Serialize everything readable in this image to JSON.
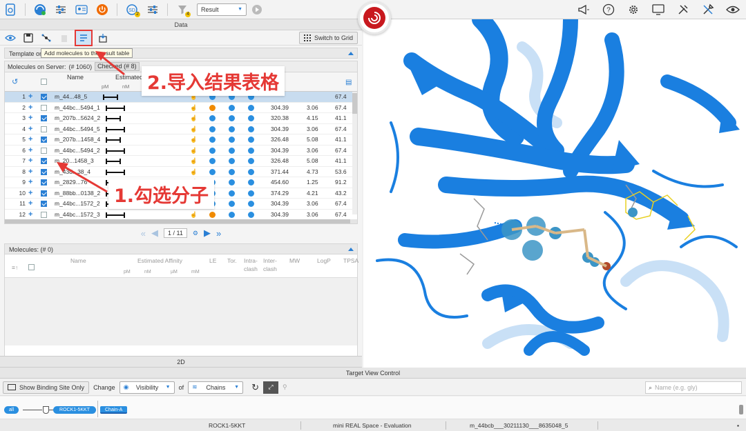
{
  "toolbar": {
    "result_dropdown": "Result",
    "badge_stack": "2",
    "badge_filter": "4"
  },
  "data_panel": {
    "title": "Data",
    "tooltip": "Add molecules to the result table",
    "switch_grid": "Switch to Grid",
    "template_bar": "Template or",
    "server_title": "Molecules on Server:",
    "server_count": "(# 1060)",
    "checked_chip": "Checked",
    "checked_count": "8",
    "headers": {
      "name": "Name",
      "affinity": "Estimated",
      "pm": "pM",
      "nm": "nM"
    },
    "rows": [
      {
        "num": "1",
        "checked": true,
        "name": "m_44...48_5",
        "mw": "",
        "logp": "",
        "tpsa": "67.4",
        "dot2": "#2a8fe0",
        "sel": true
      },
      {
        "num": "2",
        "checked": false,
        "name": "m_44bc...5494_1",
        "mw": "304.39",
        "logp": "3.06",
        "tpsa": "67.4",
        "dot2": "#f08a00",
        "sel": false
      },
      {
        "num": "3",
        "checked": true,
        "name": "m_207b...5624_2",
        "mw": "320.38",
        "logp": "4.15",
        "tpsa": "41.1",
        "dot2": "#2a8fe0",
        "sel": false
      },
      {
        "num": "4",
        "checked": false,
        "name": "m_44bc...5494_5",
        "mw": "304.39",
        "logp": "3.06",
        "tpsa": "67.4",
        "dot2": "#2a8fe0",
        "sel": false
      },
      {
        "num": "5",
        "checked": true,
        "name": "m_207b...1458_4",
        "mw": "326.48",
        "logp": "5.08",
        "tpsa": "41.1",
        "dot2": "#2a8fe0",
        "sel": false
      },
      {
        "num": "6",
        "checked": false,
        "name": "m_44bc...5494_2",
        "mw": "304.39",
        "logp": "3.06",
        "tpsa": "67.4",
        "dot2": "#2a8fe0",
        "sel": false
      },
      {
        "num": "7",
        "checked": true,
        "name": "m_20...1458_3",
        "mw": "326.48",
        "logp": "5.08",
        "tpsa": "41.1",
        "dot2": "#2a8fe0",
        "sel": false
      },
      {
        "num": "8",
        "checked": true,
        "name": "m_43d...38_4",
        "mw": "371.44",
        "logp": "4.73",
        "tpsa": "53.6",
        "dot2": "#2a8fe0",
        "sel": false
      },
      {
        "num": "9",
        "checked": true,
        "name": "m_2829...76",
        "mw": "454.60",
        "logp": "1.25",
        "tpsa": "91.2",
        "dot2": "#2a8fe0",
        "sel": false
      },
      {
        "num": "10",
        "checked": true,
        "name": "m_88bb...0138_2",
        "mw": "374.29",
        "logp": "4.21",
        "tpsa": "43.2",
        "dot2": "#2a8fe0",
        "sel": false
      },
      {
        "num": "11",
        "checked": true,
        "name": "m_44bc...1572_2",
        "mw": "304.39",
        "logp": "3.06",
        "tpsa": "67.4",
        "dot2": "#2a8fe0",
        "sel": false
      },
      {
        "num": "12",
        "checked": false,
        "name": "m_44bc...1572_3",
        "mw": "304.39",
        "logp": "3.06",
        "tpsa": "67.4",
        "dot2": "#f08a00",
        "sel": false
      }
    ],
    "pager": "1 / 11",
    "molecules_title": "Molecules:",
    "molecules_count": "(# 0)",
    "lower_headers": {
      "name": "Name",
      "affinity": "Estimated Affinity",
      "le": "LE",
      "tor": "Tor.",
      "intra": "Intra-",
      "intra2": "clash",
      "inter": "Inter-",
      "inter2": "clash",
      "mw": "MW",
      "logp": "LogP",
      "tpsa": "TPSA",
      "pm": "pM",
      "nm": "nM",
      "um": "µM",
      "mm": "mM"
    },
    "bar_2d": "2D"
  },
  "target_view": {
    "title": "Target View Control",
    "show_binding": "Show Binding Site Only",
    "change": "Change",
    "visibility": "Visibility",
    "of": "of",
    "chains": "Chains",
    "name_placeholder": "Name (e.g. gly)",
    "pill_all": "all",
    "pill_target": "ROCK1-5KKT",
    "pill_chain": "Chain-A"
  },
  "status": {
    "target": "ROCK1-5KKT",
    "library": "mini REAL Space - Evaluation",
    "molecule": "m_44bcb___30211130___8635048_5"
  },
  "annotations": {
    "step2": "2.导入结果表格",
    "step1": "1.勾选分子"
  },
  "colors": {
    "accent": "#2a7fd4",
    "highlight": "#e53935",
    "ribbon": "#1a7fe0"
  }
}
